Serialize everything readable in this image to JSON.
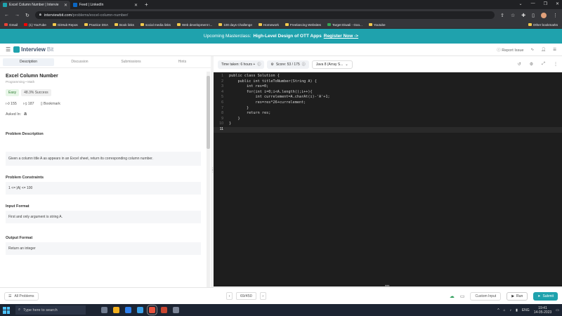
{
  "browser": {
    "tabs": [
      {
        "title": "Excel Column Number | Intervie",
        "color": "#1fa2ad",
        "active": true
      },
      {
        "title": "Feed | LinkedIn",
        "color": "#0a66c2",
        "active": false
      }
    ],
    "url_host": "interviewbit.com",
    "url_path": "/problems/excel-column-number/",
    "bookmarks": [
      "Gmail",
      "(1) YouTube",
      "GitHub Repos",
      "Practice DSA",
      "Book links",
      "social media links",
      "Web development t...",
      "100 days Challenge",
      "Homework",
      "Freelancing Websites",
      "Target Diwali - Goo...",
      "Youtube"
    ],
    "other_bookmarks": "Other bookmarks"
  },
  "banner": {
    "prefix": "Upcoming Masterclass:",
    "title": "High-Level Design of OTT Apps",
    "cta": "Register Now ->"
  },
  "header": {
    "logo_a": "Interview",
    "logo_b": "Bit",
    "report": "Report Issue"
  },
  "left": {
    "tabs": [
      "Description",
      "Discussion",
      "Submissions",
      "Hints"
    ],
    "title": "Excel Column Number",
    "tags": "Programming  •  Math",
    "difficulty": "Easy",
    "success": "48.3% Success",
    "likes": "155",
    "dislikes": "187",
    "bookmark": "Bookmark",
    "asked_in": "Asked In:",
    "sections": {
      "desc_title": "Problem Description",
      "desc_text": "Given a column title A as appears in an Excel sheet, return its corresponding column number.",
      "constraints_title": "Problem Constraints",
      "constraints_text": "1 <= |A| <= 100",
      "input_title": "Input Format",
      "input_text": "First and only argument is string A.",
      "output_title": "Output Format",
      "output_text": "Return an integer"
    }
  },
  "editor": {
    "time_taken": "Time taken: 6 hours +",
    "score": "Score: 53 / 175",
    "language": "Java 8 (Array S...",
    "lines": [
      "public class Solution {",
      "    public int titleToNumber(String A) {",
      "        int res=0;",
      "        for(int i=0;i<A.length();i++){",
      "            int currelement=A.charAt(i)-'A'+1;",
      "            res=res*26+currelement;",
      "        }",
      "        return res;",
      "    }",
      "}",
      ""
    ],
    "line_numbers": [
      "1",
      "2",
      "3",
      "4",
      "5",
      "6",
      "7",
      "8",
      "9",
      "10",
      "11"
    ]
  },
  "bottom": {
    "all_problems": "All Problems",
    "page": "69/450",
    "custom_input": "Custom Input",
    "run": "Run",
    "submit": "Submit"
  },
  "taskbar": {
    "search": "Type here to search",
    "lang": "ENG",
    "time": "19:41",
    "date": "14-05-2023"
  }
}
